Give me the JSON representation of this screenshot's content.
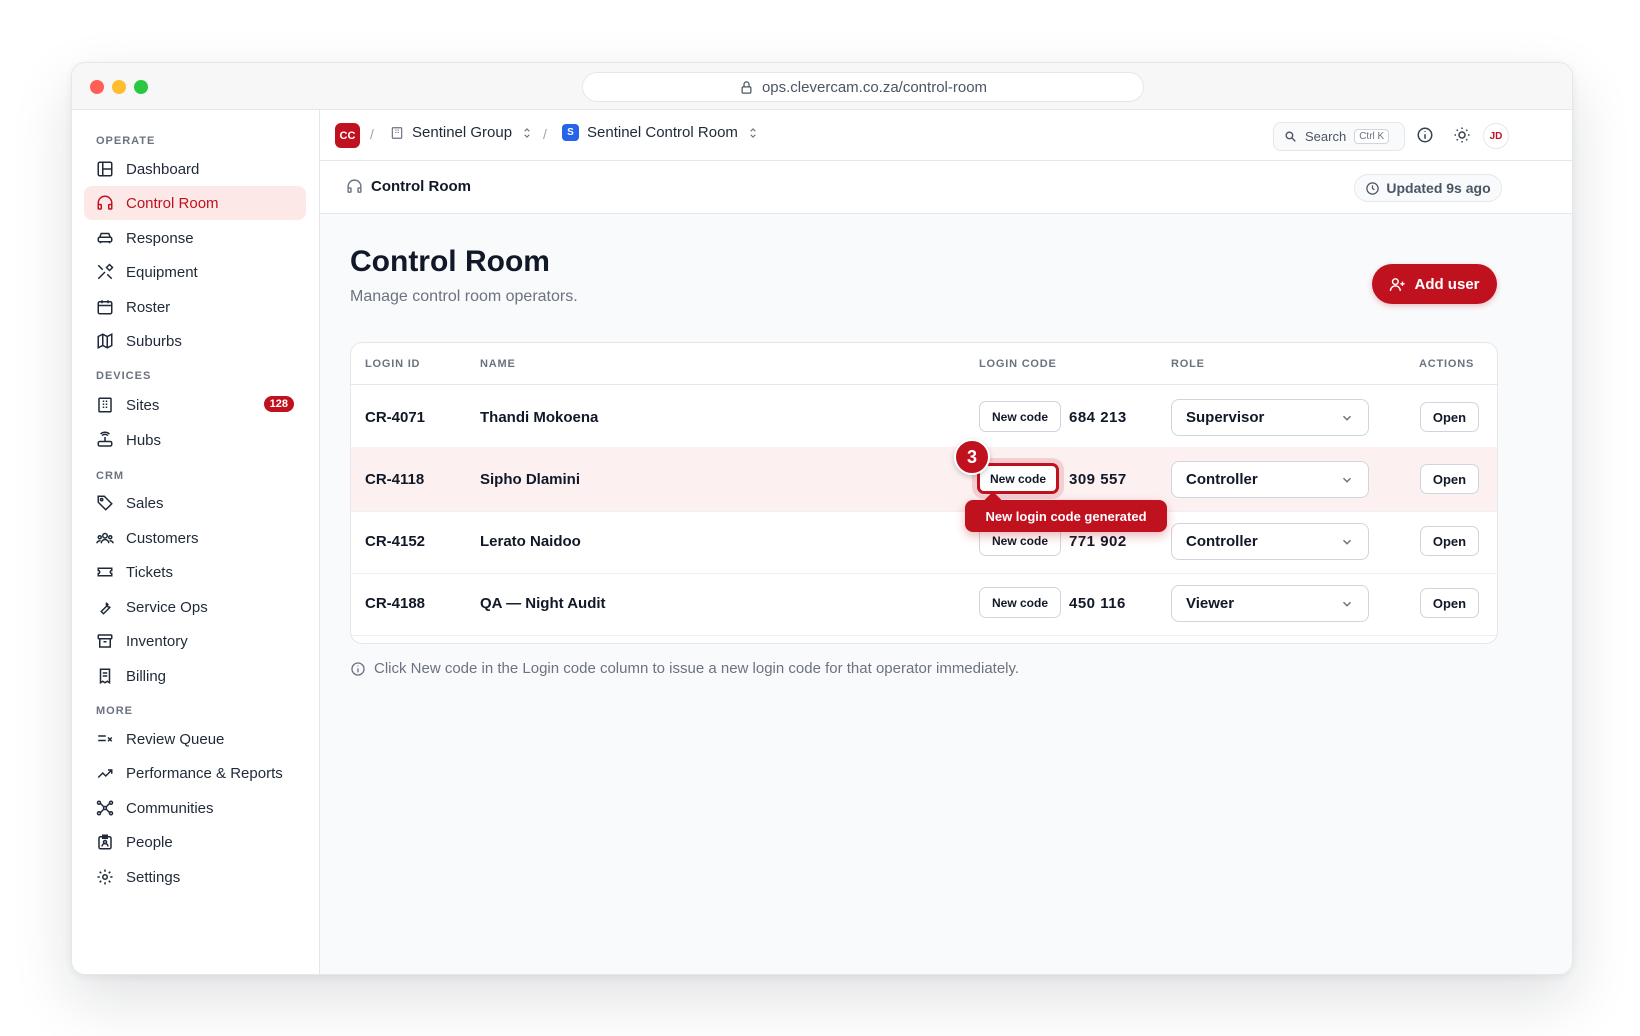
{
  "browser": {
    "url": "ops.clevercam.co.za/control-room"
  },
  "sidebar": {
    "sections": [
      {
        "title": "OPERATE"
      },
      {
        "title": "DEVICES"
      },
      {
        "title": "CRM"
      },
      {
        "title": "MORE"
      }
    ],
    "items": [
      {
        "label": "Dashboard"
      },
      {
        "label": "Control Room"
      },
      {
        "label": "Response"
      },
      {
        "label": "Equipment"
      },
      {
        "label": "Roster"
      },
      {
        "label": "Suburbs"
      },
      {
        "label": "Sites",
        "badge": "128"
      },
      {
        "label": "Hubs"
      },
      {
        "label": "Sales"
      },
      {
        "label": "Customers"
      },
      {
        "label": "Tickets"
      },
      {
        "label": "Service Ops"
      },
      {
        "label": "Inventory"
      },
      {
        "label": "Billing"
      },
      {
        "label": "Review Queue"
      },
      {
        "label": "Performance & Reports"
      },
      {
        "label": "Communities"
      },
      {
        "label": "People"
      },
      {
        "label": "Settings"
      }
    ]
  },
  "topbar": {
    "brand": "CC",
    "separator": "/",
    "org": "Sentinel Group",
    "workspace_badge": "S",
    "workspace": "Sentinel Control Room",
    "search_label": "Search",
    "search_shortcut": "Ctrl K",
    "avatar": "JD"
  },
  "subheader": {
    "title": "Control Room",
    "updated": "Updated 9s ago"
  },
  "page": {
    "title": "Control Room",
    "subtitle": "Manage control room operators.",
    "add_button": "Add user"
  },
  "table": {
    "headers": [
      "LOGIN ID",
      "NAME",
      "LOGIN CODE",
      "ROLE",
      "ACTIONS"
    ],
    "new_code_label": "New code",
    "open_label": "Open",
    "rows": [
      {
        "login_id": "CR-4071",
        "name": "Thandi Mokoena",
        "code": "684 213",
        "role": "Supervisor"
      },
      {
        "login_id": "CR-4118",
        "name": "Sipho Dlamini",
        "code": "309 557",
        "role": "Controller"
      },
      {
        "login_id": "CR-4152",
        "name": "Lerato Naidoo",
        "code": "771 902",
        "role": "Controller"
      },
      {
        "login_id": "CR-4188",
        "name": "QA — Night Audit",
        "code": "450 116",
        "role": "Viewer"
      }
    ]
  },
  "annotation": {
    "step": "3",
    "tooltip": "New login code generated"
  },
  "hint": "Click New code in the Login code column to issue a new login code for that operator immediately.",
  "colors": {
    "accent": "#c0111f",
    "accent_soft": "#fde8e8",
    "workspace_badge": "#2563eb"
  }
}
